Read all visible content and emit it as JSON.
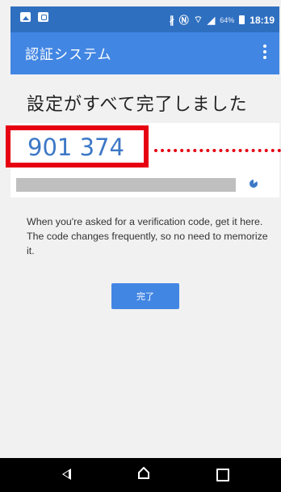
{
  "status_bar": {
    "battery_percent": "64%",
    "time": "18:19",
    "icons": [
      "photo-icon",
      "bag-icon",
      "bluetooth-icon",
      "nfc-icon",
      "wifi-icon",
      "signal-icon",
      "battery-icon"
    ]
  },
  "app_bar": {
    "title": "認証システム",
    "overflow_icon": "more-vert-icon"
  },
  "main": {
    "title": "設定がすべて完了しました",
    "verification_code": "901 374",
    "code_timer_remaining": 0.85,
    "help_text": "When you're asked for a verification code, get it here. The code changes frequently, so no need to memorize it.",
    "done_button_label": "完了"
  },
  "nav_bar": {
    "icons": [
      "back-icon",
      "home-icon",
      "recent-apps-icon"
    ]
  },
  "colors": {
    "status_bar": "#2f6fc0",
    "app_bar": "#4286e3",
    "code_text": "#3d78c6",
    "highlight": "#e60012"
  }
}
